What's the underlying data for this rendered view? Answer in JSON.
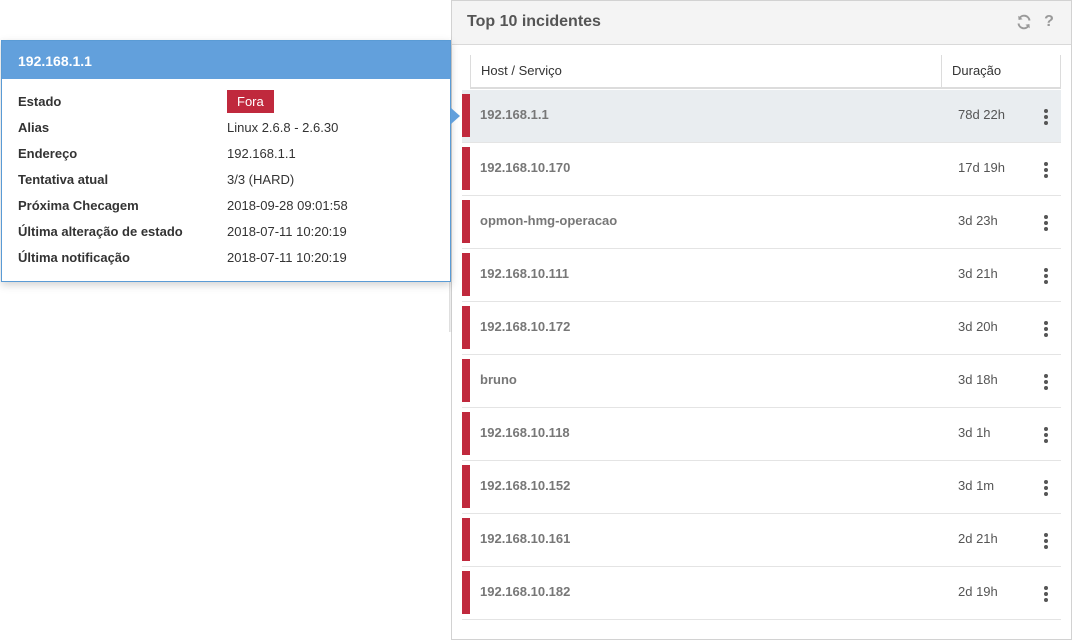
{
  "widget": {
    "title": "Top 10 incidentes",
    "refresh_icon": "refresh-icon",
    "help_label": "?",
    "columns": {
      "host": "Host / Serviço",
      "duration": "Duração"
    },
    "rows": [
      {
        "host": "192.168.1.1",
        "duration": "78d 22h",
        "selected": true
      },
      {
        "host": "192.168.10.170",
        "duration": "17d 19h"
      },
      {
        "host": "opmon-hmg-operacao",
        "duration": "3d 23h"
      },
      {
        "host": "192.168.10.111",
        "duration": "3d 21h"
      },
      {
        "host": "192.168.10.172",
        "duration": "3d 20h"
      },
      {
        "host": "bruno",
        "duration": "3d 18h"
      },
      {
        "host": "192.168.10.118",
        "duration": "3d 1h"
      },
      {
        "host": "192.168.10.152",
        "duration": "3d 1m"
      },
      {
        "host": "192.168.10.161",
        "duration": "2d 21h"
      },
      {
        "host": "192.168.10.182",
        "duration": "2d 19h"
      }
    ],
    "status_color": "#c0293d"
  },
  "popover": {
    "title": "192.168.1.1",
    "fields": [
      {
        "label": "Estado",
        "value": "Fora",
        "badge": true
      },
      {
        "label": "Alias",
        "value": "Linux 2.6.8 - 2.6.30"
      },
      {
        "label": "Endereço",
        "value": "192.168.1.1"
      },
      {
        "label": "Tentativa atual",
        "value": "3/3 (HARD)"
      },
      {
        "label": "Próxima Checagem",
        "value": "2018-09-28 09:01:58"
      },
      {
        "label": "Última alteração de estado",
        "value": "2018-07-11 10:20:19"
      },
      {
        "label": "Última notificação",
        "value": "2018-07-11 10:20:19"
      }
    ],
    "accent_color": "#62a0dc"
  }
}
